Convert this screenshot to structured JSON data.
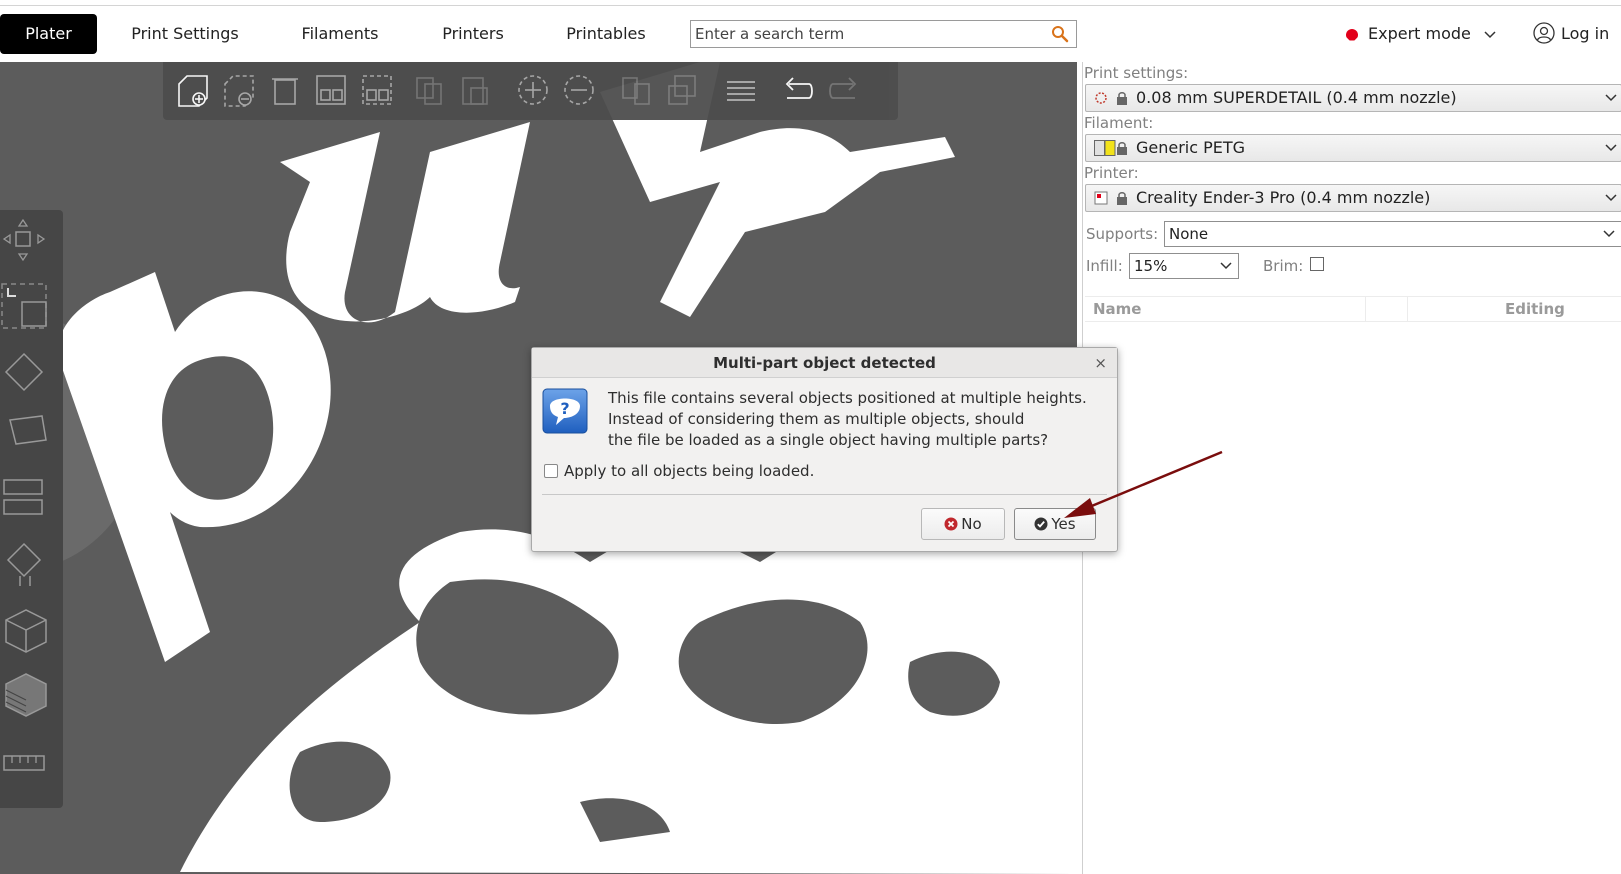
{
  "tabs": [
    {
      "label": "Plater",
      "active": true
    },
    {
      "label": "Print Settings"
    },
    {
      "label": "Filaments"
    },
    {
      "label": "Printers"
    },
    {
      "label": "Printables"
    }
  ],
  "search": {
    "placeholder": "Enter a search term",
    "icon": "search-icon"
  },
  "mode": {
    "label": "Expert mode",
    "color": "#e2001a"
  },
  "account": {
    "label": "Log in",
    "icon": "user-icon"
  },
  "toolbar": {
    "icons": [
      "add-icon",
      "delete-icon",
      "delete-all-icon",
      "arrange-icon",
      "arrange-selection-icon",
      "copy-icon",
      "paste-icon",
      "add-instance-icon",
      "remove-instance-icon",
      "split-objects-icon",
      "split-parts-icon",
      "layers-icon",
      "undo-icon",
      "redo-icon"
    ]
  },
  "left_tools": [
    "move-icon",
    "scale-icon",
    "rotate-icon",
    "place-on-face-icon",
    "cut-icon",
    "paint-supports-icon",
    "seam-painting-icon",
    "variable-layer-icon",
    "measure-icon"
  ],
  "sidebar": {
    "print_settings_label": "Print settings:",
    "print_settings_value": "0.08 mm SUPERDETAIL (0.4 mm nozzle)",
    "filament_label": "Filament:",
    "filament_value": "Generic PETG",
    "printer_label": "Printer:",
    "printer_value": "Creality Ender-3 Pro (0.4 mm nozzle)",
    "supports_label": "Supports:",
    "supports_value": "None",
    "infill_label": "Infill:",
    "infill_value": "15%",
    "brim_label": "Brim:",
    "list_headers": {
      "name": "Name",
      "editing": "Editing"
    }
  },
  "dialog": {
    "title": "Multi-part object detected",
    "close": "×",
    "message_lines": [
      "This file contains several objects positioned at multiple heights.",
      "Instead of considering them as multiple objects, should",
      "the file be loaded as a single object having multiple parts?"
    ],
    "checkbox_label": "Apply to all objects being loaded.",
    "no_label": "No",
    "yes_label": "Yes"
  }
}
